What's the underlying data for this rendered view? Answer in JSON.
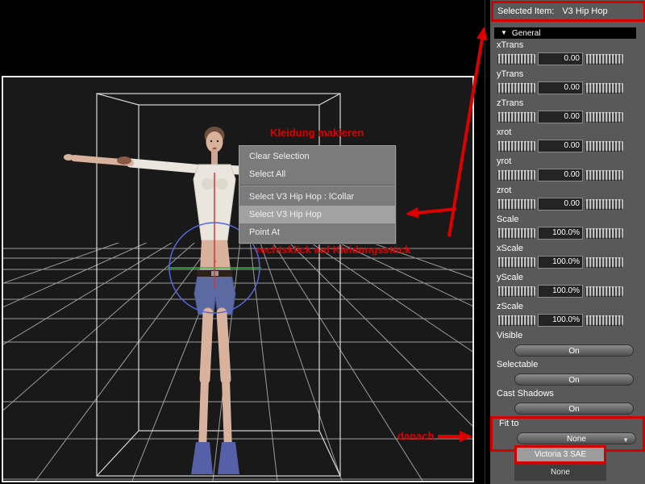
{
  "annotations": {
    "mark_clothing": "Kleidung makieren",
    "right_click": "rechtsklick auf Kleidungsstück",
    "then": "danach"
  },
  "context_menu": {
    "items": [
      {
        "label": "Clear Selection"
      },
      {
        "label": "Select All"
      },
      {
        "label": "Select V3 Hip Hop : lCollar"
      },
      {
        "label": "Select V3 Hip Hop"
      },
      {
        "label": "Point At"
      }
    ]
  },
  "panel": {
    "selected_item": {
      "label": "Selected Item:",
      "value": "V3 Hip Hop"
    },
    "section": {
      "label": "General",
      "icon": "▼"
    },
    "dials": [
      {
        "label": "xTrans",
        "value": "0.00"
      },
      {
        "label": "yTrans",
        "value": "0.00"
      },
      {
        "label": "zTrans",
        "value": "0.00"
      },
      {
        "label": "xrot",
        "value": "0.00"
      },
      {
        "label": "yrot",
        "value": "0.00"
      },
      {
        "label": "zrot",
        "value": "0.00"
      },
      {
        "label": "Scale",
        "value": "100.0%"
      },
      {
        "label": "xScale",
        "value": "100.0%"
      },
      {
        "label": "yScale",
        "value": "100.0%"
      },
      {
        "label": "zScale",
        "value": "100.0%"
      }
    ],
    "toggles": [
      {
        "label": "Visible",
        "value": "On"
      },
      {
        "label": "Selectable",
        "value": "On"
      },
      {
        "label": "Cast Shadows",
        "value": "On"
      }
    ],
    "fit_to": {
      "label": "Fit to",
      "value": "None",
      "icon": "▼"
    },
    "dropdown": {
      "options": [
        {
          "label": "Victoria 3 SAE"
        },
        {
          "label": "None"
        }
      ]
    }
  },
  "colors": {
    "annotation_red": "#dd0000",
    "panel_bg": "#595959",
    "menu_bg": "#7b7b7b",
    "menu_highlight": "#a2a2a2",
    "viewport_bg": "#191919"
  }
}
